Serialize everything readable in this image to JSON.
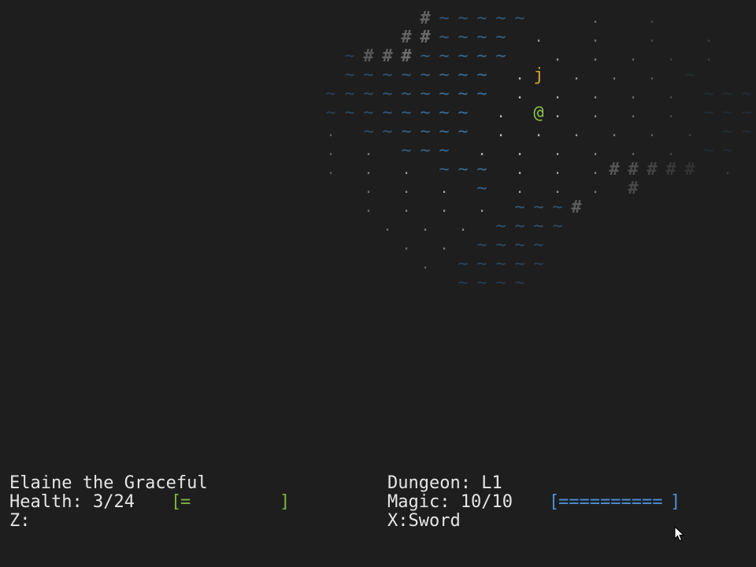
{
  "map": {
    "colors": {
      "wall": "#8a8a8a",
      "water": "#3a6e9a",
      "floor": "#bdbdbd",
      "player": "#8cc34a",
      "monster": "#d4a632"
    },
    "rows": [
      "                      #~~~~~   .  .",
      "                     ##~~~~ .  .  .  .",
      "                  ~###~~~~~  . . . . .",
      "                  ~~~~~~~~ .j . . . ~",
      "                 ~~~~~~~~~ . . . . . ~~~",
      "                 ~~~~~~~~ . @. . . . ~~~",
      "                 . ~~~~~~ . . . . . . ~~",
      "                 . . ~~~ . . . . . . ~~",
      "                 . . . ~~~ . . .##### . ~",
      "                   . . . ~ . . . #",
      "                   . . . . ~~~#",
      "                    . . . ~~~~",
      "                     . . ~~~~",
      "                      . ~~~~~",
      "                        ~~~~"
    ]
  },
  "status": {
    "name": "Elaine the Graceful",
    "health_label": "Health: 3/24",
    "health_bar_open": "[",
    "health_bar_fill": "=",
    "health_bar_close": "]",
    "health_fraction": 0.125,
    "z_label": "Z:",
    "dungeon_label": "Dungeon: L1",
    "magic_label": "Magic: 10/10",
    "magic_bar_open": "[",
    "magic_bar_fill": "==========",
    "magic_bar_close": "]",
    "magic_fraction": 1.0,
    "x_label": "X:Sword",
    "health_bar_color": "#7cb342",
    "magic_bar_color": "#4a90d9"
  },
  "cursor": {
    "icon": "mouse-pointer-icon"
  }
}
